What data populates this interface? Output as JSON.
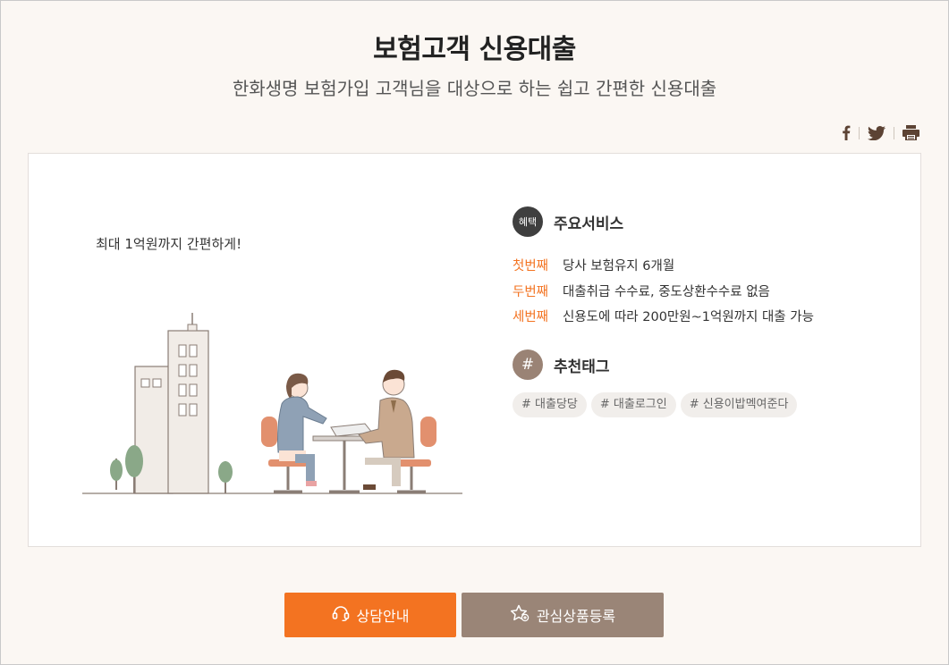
{
  "header": {
    "title": "보험고객 신용대출",
    "subtitle": "한화생명 보험가입 고객님을 대상으로 하는 쉽고 간편한 신용대출"
  },
  "share": {
    "icons": [
      "facebook-icon",
      "twitter-icon",
      "print-icon"
    ]
  },
  "card": {
    "tagline": "최대 1억원까지 간편하게!",
    "services": {
      "badge": "혜택",
      "title": "주요서비스",
      "items": [
        {
          "label": "첫번째",
          "text": "당사 보험유지 6개월"
        },
        {
          "label": "두번째",
          "text": "대출취급 수수료, 중도상환수수료 없음"
        },
        {
          "label": "세번째",
          "text": "신용도에 따라 200만원~1억원까지 대출 가능"
        }
      ]
    },
    "tags": {
      "badge": "#",
      "title": "추천태그",
      "items": [
        "# 대출당당",
        "# 대출로그인",
        "# 신용이밥멕여준다"
      ]
    }
  },
  "actions": {
    "consult_label": "상담안내",
    "favorite_label": "관심상품등록"
  },
  "colors": {
    "accent": "#f37321",
    "secondary": "#9a8577",
    "background": "#fbf7f3"
  }
}
